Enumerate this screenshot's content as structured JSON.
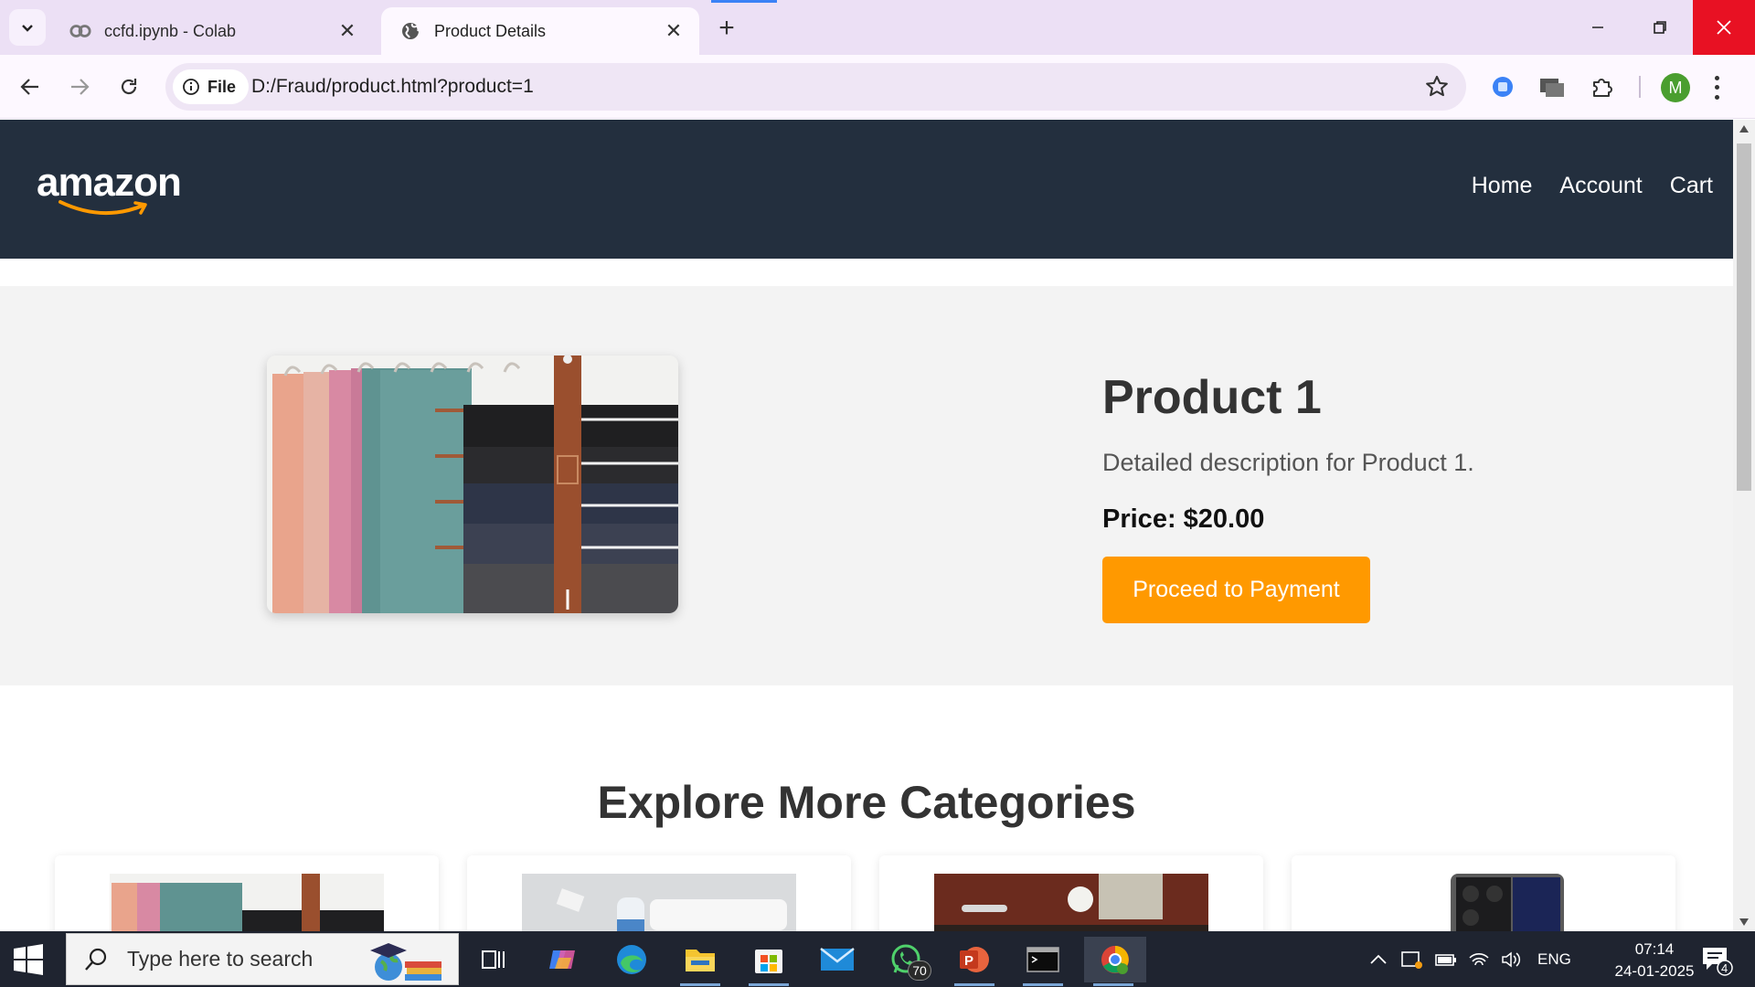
{
  "browser": {
    "tabs": [
      {
        "title": "ccfd.ipynb - Colab",
        "icon": "colab-icon",
        "active": false
      },
      {
        "title": "Product Details",
        "icon": "globe-icon",
        "active": true
      }
    ],
    "address": {
      "chip_label": "File",
      "url": "D:/Fraud/product.html?product=1"
    },
    "profile_initial": "M"
  },
  "site": {
    "logo_text": "amazon",
    "nav": {
      "home": "Home",
      "account": "Account",
      "cart": "Cart"
    },
    "colors": {
      "header": "#232f3e",
      "accent": "#ff9900"
    }
  },
  "product": {
    "title": "Product 1",
    "description": "Detailed description for Product 1.",
    "price": "Price: $20.00",
    "pay_button": "Proceed to Payment"
  },
  "explore": {
    "title": "Explore More Categories",
    "categories": [
      {
        "thumb": "pants-hanger"
      },
      {
        "thumb": "toothpaste"
      },
      {
        "thumb": "furniture-decor"
      },
      {
        "thumb": "smartphone"
      }
    ]
  },
  "taskbar": {
    "search_placeholder": "Type here to search",
    "whatsapp_badge": "70",
    "language": "ENG",
    "time": "07:14",
    "date": "24-01-2025",
    "notifications": "4"
  }
}
